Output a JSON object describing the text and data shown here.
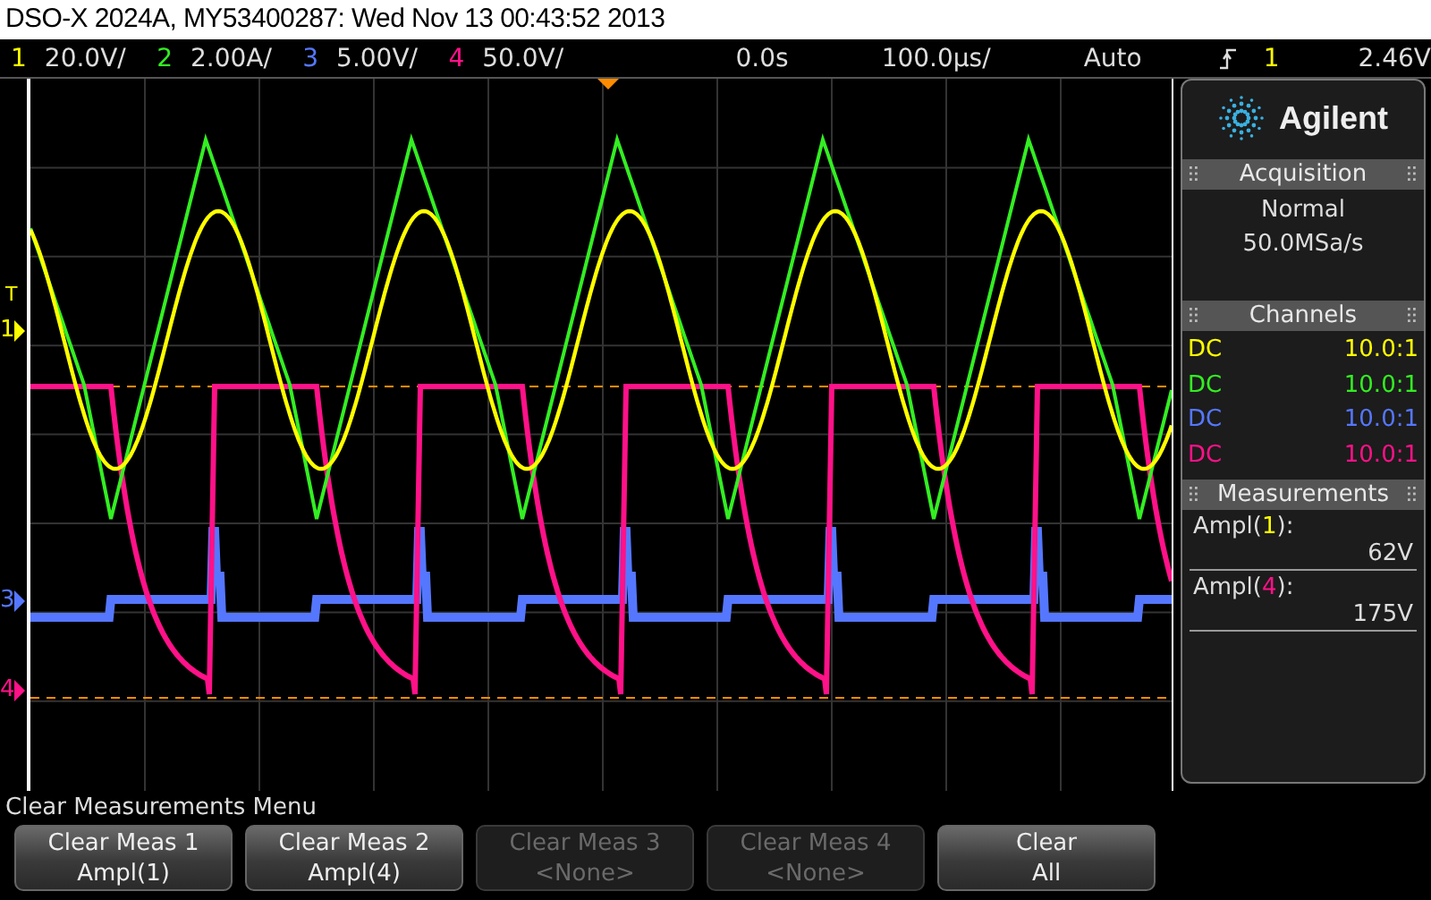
{
  "title": "DSO-X 2024A, MY53400287: Wed Nov 13 00:43:52 2013",
  "channels": [
    {
      "number": "1",
      "scale": "20.0V/",
      "color": "#ffff00",
      "coupling": "DC",
      "probe": "10.0:1"
    },
    {
      "number": "2",
      "scale": "2.00A/",
      "color": "#33ee22",
      "coupling": "DC",
      "probe": "10.0:1"
    },
    {
      "number": "3",
      "scale": "5.00V/",
      "color": "#5577ff",
      "coupling": "DC",
      "probe": "10.0:1"
    },
    {
      "number": "4",
      "scale": "50.0V/",
      "color": "#ff1188",
      "coupling": "DC",
      "probe": "10.0:1"
    }
  ],
  "timebase": {
    "delay": "0.0s",
    "scale": "100.0µs/"
  },
  "trigger": {
    "mode": "Auto",
    "source": "1",
    "level": "2.46V",
    "marker": "T"
  },
  "ground_markers": [
    {
      "channel": "1",
      "color": "#ffff00"
    },
    {
      "channel": "3",
      "color": "#5577ff"
    },
    {
      "channel": "4",
      "color": "#ff1188"
    }
  ],
  "panel": {
    "brand": "Agilent",
    "acquisition": {
      "title": "Acquisition",
      "mode": "Normal",
      "rate": "50.0MSa/s"
    },
    "channels_title": "Channels",
    "measurements": {
      "title": "Measurements",
      "items": [
        {
          "prefix": "Ampl(",
          "channel": "1",
          "suffix": "):",
          "color": "#ffff00",
          "value": "62V"
        },
        {
          "prefix": "Ampl(",
          "channel": "4",
          "suffix": "):",
          "color": "#ff1188",
          "value": "175V"
        }
      ]
    }
  },
  "menu": {
    "title": "Clear Measurements Menu",
    "softkeys": [
      {
        "top": "Clear Meas 1",
        "bottom": "Ampl(1)",
        "disabled": false
      },
      {
        "top": "Clear Meas 2",
        "bottom": "Ampl(4)",
        "disabled": false
      },
      {
        "top": "Clear Meas 3",
        "bottom": "<None>",
        "disabled": true
      },
      {
        "top": "Clear Meas 4",
        "bottom": "<None>",
        "disabled": true
      },
      {
        "top": "Clear",
        "bottom": "All",
        "disabled": false
      }
    ]
  }
}
